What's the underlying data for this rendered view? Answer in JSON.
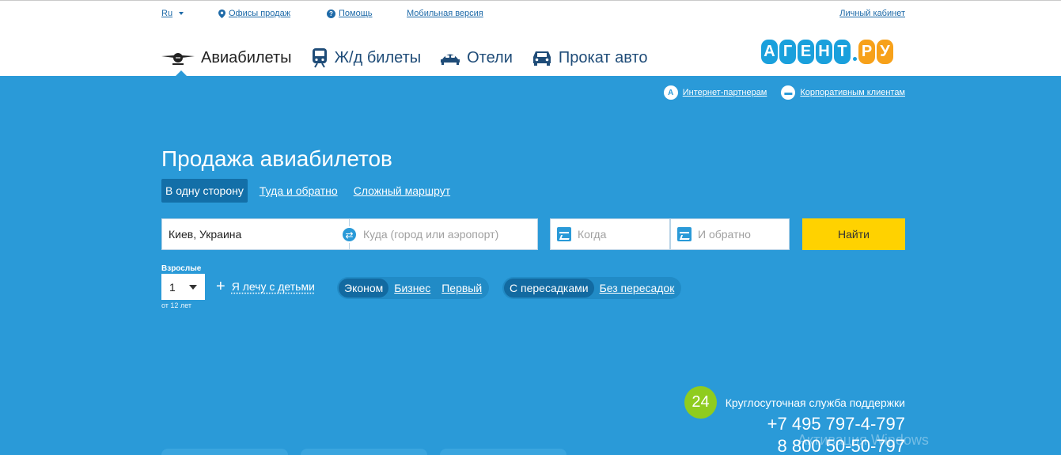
{
  "top": {
    "lang": "Ru",
    "offices": "Офисы продаж",
    "help": "Помощь",
    "mobile": "Мобильная версия",
    "account": "Личный кабинет"
  },
  "nav": {
    "air": "Авиабилеты",
    "rail": "Ж/д билеты",
    "hotels": "Отели",
    "cars": "Прокат авто"
  },
  "logo": {
    "letters": [
      "А",
      "Г",
      "Е",
      "Н",
      "Т"
    ],
    "suffix": [
      "Р",
      "У"
    ],
    "colors": {
      "main": "#1aa0dc",
      "suffix": "#f7a11a"
    }
  },
  "partners": {
    "internet": "Интернет-партнерам",
    "corporate": "Корпоративным клиентам"
  },
  "search": {
    "title": "Продажа авиабилетов",
    "trip_tabs": [
      "В одну сторону",
      "Туда и обратно",
      "Сложный маршрут"
    ],
    "active_trip_tab": "В одну сторону",
    "from_value": "Киев, Украина",
    "to_placeholder": "Куда (город или аэропорт)",
    "depart_placeholder": "Когда",
    "return_placeholder": "И обратно",
    "find_button": "Найти",
    "adults_label": "Взрослые",
    "adults_value": "1",
    "adults_note": "от 12 лет",
    "kids_link": "Я лечу с детьми",
    "classes": [
      "Эконом",
      "Бизнес",
      "Первый"
    ],
    "active_class": "Эконом",
    "stops": [
      "С пересадками",
      "Без пересадок"
    ],
    "active_stops": "С пересадками"
  },
  "support": {
    "badge": "24",
    "label": "Круглосуточная служба поддержки",
    "phone1": "+7 495 797-4-797",
    "phone2": "8 800 50-50-797"
  },
  "overlay": {
    "watermark": "Активация Windows"
  },
  "colors": {
    "background": "#2a9ad8",
    "find_button": "#ffd200",
    "support_badge": "#8fcc1f"
  }
}
